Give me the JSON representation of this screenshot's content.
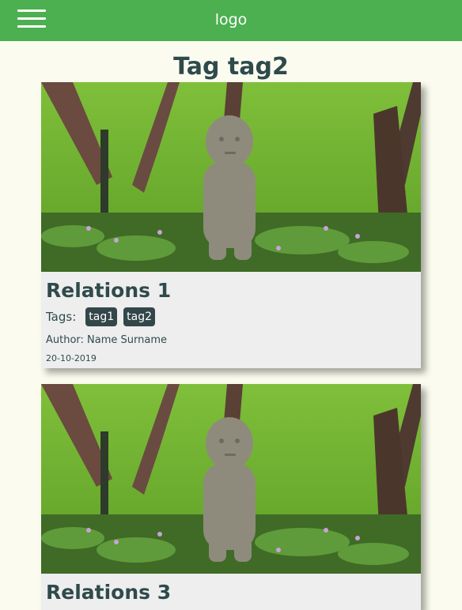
{
  "header": {
    "logo_text": "logo",
    "menu_icon": "hamburger-menu-icon",
    "background_color": "#4caf50"
  },
  "page": {
    "title": "Tag tag2",
    "background_color": "#fbfcef"
  },
  "posts": [
    {
      "title": "Relations 1",
      "tags_label": "Tags:",
      "tags": [
        "tag1",
        "tag2"
      ],
      "author": "Author: Name Surname",
      "date": "20-10-2019",
      "image": "stone-child-statue-in-garden"
    },
    {
      "title": "Relations 3",
      "image": "stone-child-statue-in-garden"
    }
  ]
}
